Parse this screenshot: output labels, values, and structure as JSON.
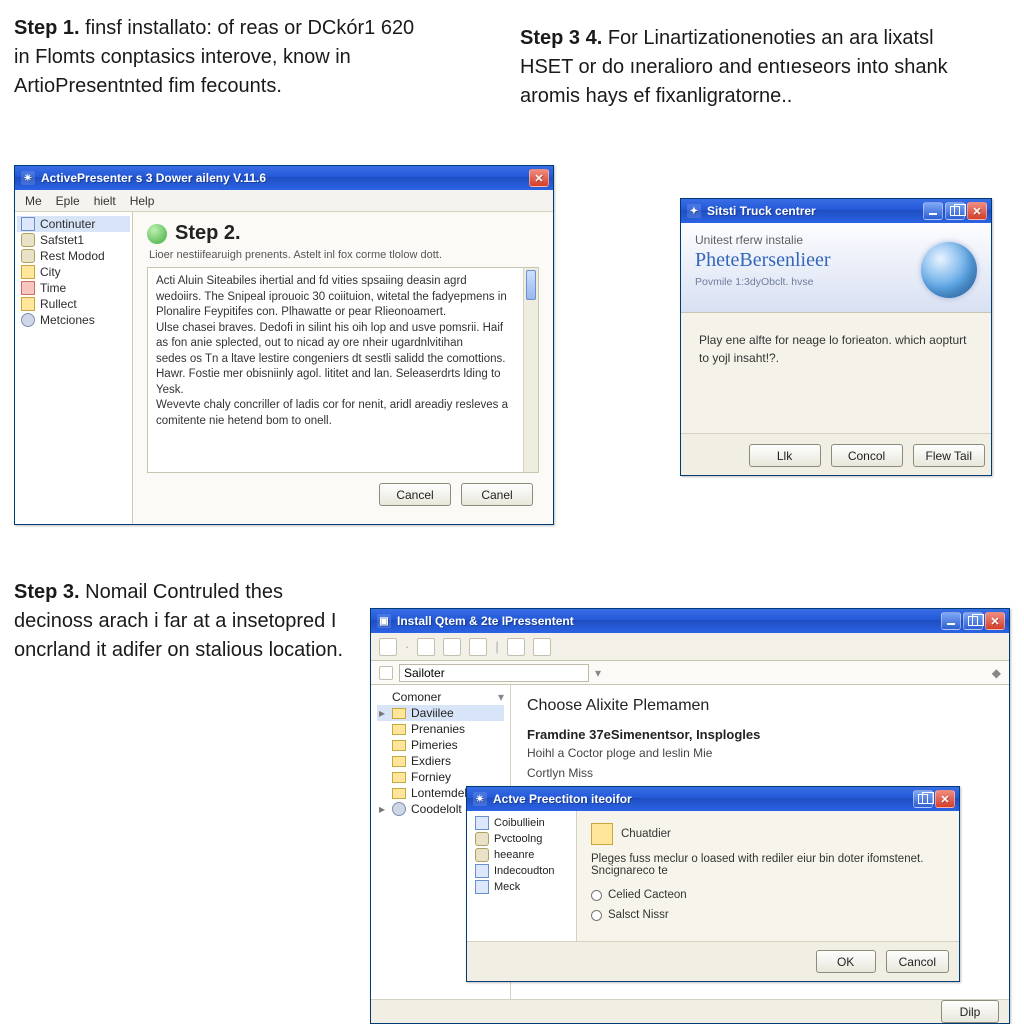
{
  "step1": {
    "label": "Step 1.",
    "text": "finsf installato: of reas or DCkór1 620 in Flomts conptasics interove, know in ArtioPresentnted fim fecounts."
  },
  "step34_top": {
    "label": "Step 3 4.",
    "text": "For Linartizationenoties an ara lixatsl HSET or do ıneralioro and entıeseors into shank aromis hays ef fixanligratorne.."
  },
  "step3": {
    "label": "Step 3.",
    "text": "Nomail Contruled thes decinoss arach i far at a insetopred I oncrland it adifer on stalious location."
  },
  "win1": {
    "title": "ActivePresenter s 3 Dower aileny V.11.6",
    "menu": [
      "Me",
      "Eple",
      "hielt",
      "Help"
    ],
    "sidebar": [
      "Continuter",
      "Safstet1",
      "Rest Modod",
      "City",
      "Time",
      "Rullect",
      "Metciones"
    ],
    "step_label": "Step 2.",
    "sub": "Lioer nestiifearuigh prenents. Astelt inl fox corme tlolow dott.",
    "body": "Acti Aluin Siteabiles ihertial and fd vities spsaiing deasin agrd wedoiirs. The Snipeal iprouoic 30 coiituion, witetal the fadyepmens in Plonalire Feypitifes con. Plhawatte or pear Rlieonoamert.\nUlse chasei braves. Dedofi in silint his oih lop and usve pomsrii. Haif as fon anie splected, out to nicad ay ore nheir ugardnlvitihan\nsedes os Tn a ltave lestire congeniers dt sestli salidd the comottions. Hawr. Fostie mer obisniinly agol. lititet and lan. Seleaserdrts lding to Yesk.\nWevevte chaly concriller of ladis cor for nenit, aridl areadiy resleves a comitente nie hetend bom to onell.",
    "buttons": [
      "Cancel",
      "Canel"
    ]
  },
  "win2": {
    "title": "Sitsti Truck centrer",
    "h1": "Unitest rferw instalie",
    "h2": "PheteBersenlieer",
    "h3": "Povmile 1:3dyObclt. hvse",
    "body": "Play ene alfte for neage lo forieaton. which aopturt to yojl insaht!?.",
    "buttons": [
      "Llk",
      "Concol",
      "Flew Tail"
    ]
  },
  "win3": {
    "title": "Install Qtem & 2te IPressentent",
    "addr_label": "Sailoter",
    "tree_root": "Comoner",
    "tree": [
      "Daviilee",
      "Prenanies",
      "Pimeries",
      "Exdiers",
      "Forniey",
      "Lontemdeblan",
      "Coodelolt"
    ],
    "content_title": "Choose Alixite Plemamen",
    "sec1": "Framdine 37eSimenentsor, Insplogles",
    "line1": "Hoihl a Coctor ploge and leslin Mie",
    "line2": "Cortlyn Miss"
  },
  "win4": {
    "title": "Actve Preectiton iteoifor",
    "side_head": "Coibulliein",
    "side": [
      "Pvctoolng",
      "heeanre",
      "Indecoudton",
      "Meck"
    ],
    "head_icon_label": "Chuatdier",
    "body_line": "Pleges fuss meclur o loased with rediler eiur bin doter ifomstenet. Sncignareco te",
    "radio1": "Celied Cacteon",
    "radio2": "Salsct Nissr",
    "buttons": [
      "OK",
      "Cancol"
    ],
    "help": "Dilp"
  }
}
